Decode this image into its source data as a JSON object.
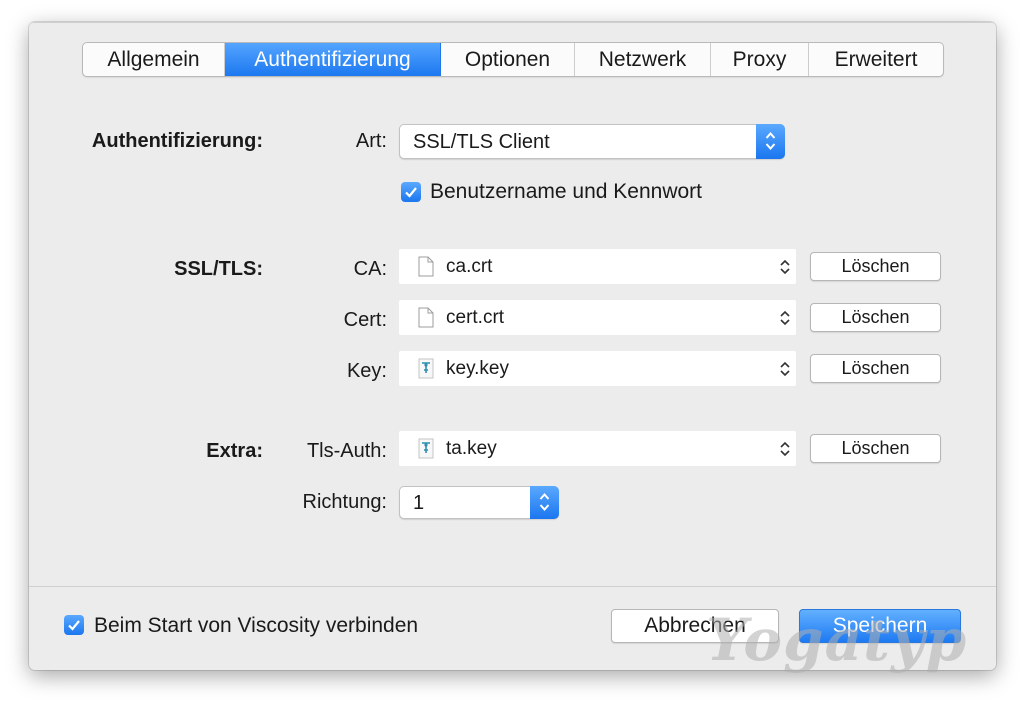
{
  "tabs": [
    {
      "label": "Allgemein",
      "active": false
    },
    {
      "label": "Authentifizierung",
      "active": true
    },
    {
      "label": "Optionen",
      "active": false
    },
    {
      "label": "Netzwerk",
      "active": false
    },
    {
      "label": "Proxy",
      "active": false
    },
    {
      "label": "Erweitert",
      "active": false
    }
  ],
  "auth": {
    "section_label": "Authentifizierung:",
    "type_label": "Art:",
    "type_value": "SSL/TLS Client",
    "userpass_label": "Benutzername und Kennwort",
    "userpass_checked": true
  },
  "ssl": {
    "section_label": "SSL/TLS:",
    "ca_label": "CA:",
    "ca_file": "ca.crt",
    "cert_label": "Cert:",
    "cert_file": "cert.crt",
    "key_label": "Key:",
    "key_file": "key.key",
    "delete_label": "Löschen"
  },
  "extra": {
    "section_label": "Extra:",
    "tlsauth_label": "Tls-Auth:",
    "tlsauth_file": "ta.key",
    "direction_label": "Richtung:",
    "direction_value": "1"
  },
  "footer": {
    "autoconnect_label": "Beim Start von Viscosity verbinden",
    "autoconnect_checked": true,
    "cancel_label": "Abbrechen",
    "save_label": "Speichern"
  },
  "watermark": "Yogatyp",
  "colors": {
    "accent": "#1d78f0",
    "window_bg": "#ececec"
  }
}
